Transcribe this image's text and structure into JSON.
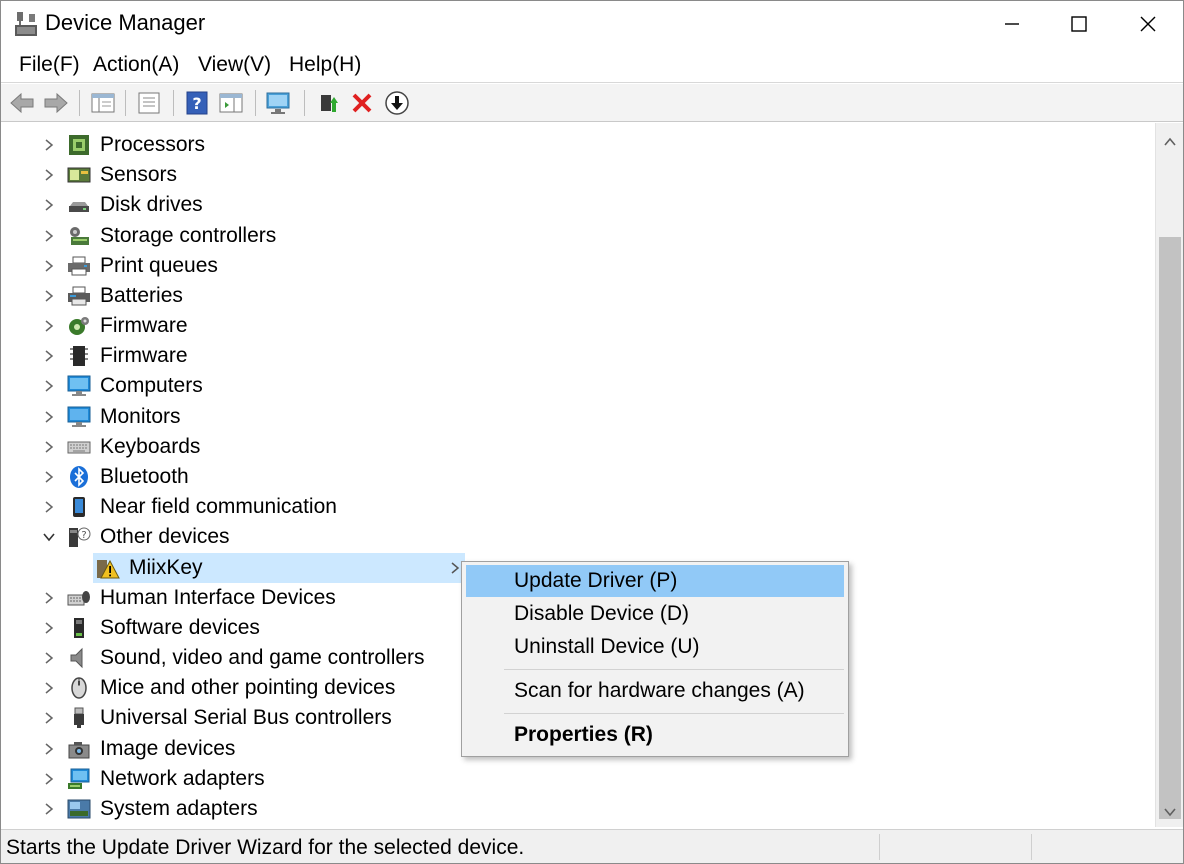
{
  "window": {
    "title": "Device Manager"
  },
  "menu": [
    "File(F)",
    "Action(A)",
    "View(V)",
    "Help(H)"
  ],
  "toolbar": {
    "buttons": [
      "back-icon",
      "forward-icon",
      "show-hide-console-tree-icon",
      "properties-icon",
      "help-icon",
      "action-pane-icon",
      "scan-hardware-icon",
      "update-driver-icon",
      "uninstall-icon",
      "download-icon"
    ]
  },
  "tree": {
    "items": [
      {
        "label": "Processors",
        "icon": "processor-icon",
        "state": "collapsed"
      },
      {
        "label": "Sensors",
        "icon": "sensor-icon",
        "state": "collapsed"
      },
      {
        "label": "Disk drives",
        "icon": "disk-drive-icon",
        "state": "collapsed"
      },
      {
        "label": "Storage controllers",
        "icon": "storage-controller-icon",
        "state": "collapsed"
      },
      {
        "label": "Print queues",
        "icon": "printer-icon",
        "state": "collapsed"
      },
      {
        "label": "Batteries",
        "icon": "battery-icon",
        "state": "collapsed"
      },
      {
        "label": "Firmware",
        "icon": "firmware-gear-icon",
        "state": "collapsed"
      },
      {
        "label": "Firmware",
        "icon": "firmware-chip-icon",
        "state": "collapsed"
      },
      {
        "label": "Computers",
        "icon": "computer-icon",
        "state": "collapsed"
      },
      {
        "label": "Monitors",
        "icon": "monitor-icon",
        "state": "collapsed"
      },
      {
        "label": "Keyboards",
        "icon": "keyboard-icon",
        "state": "collapsed"
      },
      {
        "label": "Bluetooth",
        "icon": "bluetooth-icon",
        "state": "collapsed"
      },
      {
        "label": "Near field communication",
        "icon": "nfc-icon",
        "state": "collapsed"
      },
      {
        "label": "Other devices",
        "icon": "other-devices-icon",
        "state": "expanded"
      },
      {
        "label": "MiixKey",
        "icon": "warning-device-icon",
        "state": "child-selected"
      },
      {
        "label": "Human Interface Devices",
        "icon": "hid-icon",
        "state": "collapsed"
      },
      {
        "label": "Software devices",
        "icon": "software-device-icon",
        "state": "collapsed"
      },
      {
        "label": "Sound, video and game controllers",
        "icon": "speaker-icon",
        "state": "collapsed"
      },
      {
        "label": "Mice and other pointing devices",
        "icon": "mouse-icon",
        "state": "collapsed"
      },
      {
        "label": "Universal Serial Bus controllers",
        "icon": "usb-icon",
        "state": "collapsed"
      },
      {
        "label": "Image devices",
        "icon": "camera-icon",
        "state": "collapsed"
      },
      {
        "label": "Network adapters",
        "icon": "network-adapter-icon",
        "state": "collapsed"
      },
      {
        "label": "System adapters",
        "icon": "system-adapter-icon",
        "state": "collapsed"
      }
    ]
  },
  "context_menu": {
    "items": [
      {
        "label": "Update Driver (P)",
        "highlighted": true
      },
      {
        "label": "Disable Device (D)"
      },
      {
        "label": "Uninstall Device (U)"
      },
      {
        "label": "Scan for hardware changes (A)"
      },
      {
        "label": "Properties (R)",
        "bold": true
      }
    ]
  },
  "status": {
    "text": "Starts the Update Driver Wizard for the selected device."
  },
  "colors": {
    "selection": "#cce8ff",
    "menu_highlight": "#91c9f7",
    "warning": "#f0c020"
  }
}
